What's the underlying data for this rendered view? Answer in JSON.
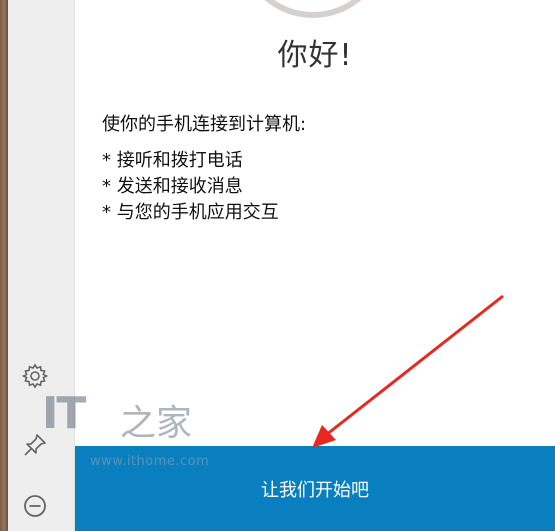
{
  "main": {
    "greeting": "你好!",
    "intro": "使你的手机连接到计算机:",
    "features": [
      "* 接听和拨打电话",
      "* 发送和接收消息",
      "* 与您的手机应用交互"
    ],
    "start_button_label": "让我们开始吧"
  },
  "rail": {
    "icons": [
      "gear-icon",
      "pin-icon",
      "minus-circle-icon"
    ]
  },
  "watermark": {
    "brand": "IT",
    "brand_suffix": "之家",
    "url": "www.ithome.com"
  },
  "colors": {
    "accent": "#0a7fc0",
    "rail_bg": "#eeeeee",
    "arrow": "#e8271e"
  }
}
